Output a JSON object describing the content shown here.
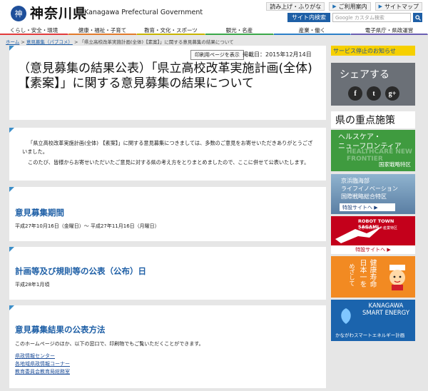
{
  "header": {
    "logo_name": "神奈川県",
    "logo_en": "Kanagawa Prefectural Government",
    "utility_links": [
      "読み上げ・ふりがな",
      "ご利用案内",
      "サイトマップ"
    ],
    "search_button": "サイト内検索",
    "search_placeholder": "Google カスタム検索"
  },
  "nav": [
    {
      "label": "くらし・安全・環境",
      "color": "#e23a3a",
      "width": 96
    },
    {
      "label": "健康・福祉・子育て",
      "color": "#e27a2a",
      "width": 96
    },
    {
      "label": "教育・文化・スポーツ",
      "color": "#c8b400",
      "width": 96
    },
    {
      "label": "観光・名産",
      "color": "#3aa84a",
      "width": 96
    },
    {
      "label": "産業・働く",
      "color": "#2c7fc8",
      "width": 108
    },
    {
      "label": "電子県庁・県政運営",
      "color": "#6a5fb3",
      "width": 108
    }
  ],
  "breadcrumb": {
    "items": [
      "ホーム",
      "意見募集（パブコメ）"
    ],
    "current": "「県立高校改革実施計画(全体)【素案】」に関する意見募集の結果について"
  },
  "page": {
    "print_label": "印刷用ページを表示",
    "date": "掲載日：2015年12月14日",
    "title": "（意見募集の結果公表）「県立高校改革実施計画(全体)【素案】」に関する意見募集の結果について",
    "intro_1": "「県立高校改革実施計画(全体) 【素案】」に関する意見募集につきましては、多数のご意見をお寄せいただきありがとうございました。",
    "intro_2": "このたび、皆様からお寄せいただいたご意見に対する県の考え方をとりまとめましたので、ここに併せて公表いたします。",
    "sections": [
      {
        "heading": "意見募集期間",
        "body": "平成27年10月16日（金曜日）～ 平成27年11月16日（月曜日）"
      },
      {
        "heading": "計画等及び規則等の公表（公布）日",
        "body": "平成28年1月頃"
      },
      {
        "heading": "意見募集結果の公表方法",
        "body": "このホームページのほか、以下の窓口で、印刷物でもご覧いただくことができます。"
      }
    ],
    "links": [
      "県政情報センター",
      "各地域県政情報コーナー",
      "教育委員会教育局総務室"
    ]
  },
  "sidebar": {
    "notice": "サービス停止のお知らせ",
    "share_title": "シェアする",
    "share_icons": [
      "f",
      "t",
      "g+"
    ],
    "key_heading": "県の重点施策",
    "banner1": {
      "line1": "ヘルスケア・",
      "line2": "ニューフロンティア",
      "en": "HEALTHCARE NEW FRONTIER",
      "zone": "国家戦略特区"
    },
    "banner2": {
      "line1": "京浜臨海部",
      "line2": "ライフイノベーション",
      "line3": "国際戦略総合特区",
      "button": "特設サイトへ"
    },
    "banner3": {
      "title": "ROBOT TOWN SAGAMI",
      "sub": "さがみロボット産業特区",
      "button": "特設サイトへ"
    },
    "banner4": {
      "col1": "健康寿命",
      "col2": "日本一を",
      "col3": "めざして"
    },
    "banner5": {
      "title": "KANAGAWA SMART ENERGY",
      "sub": "かながわスマートエネルギー計画"
    }
  }
}
